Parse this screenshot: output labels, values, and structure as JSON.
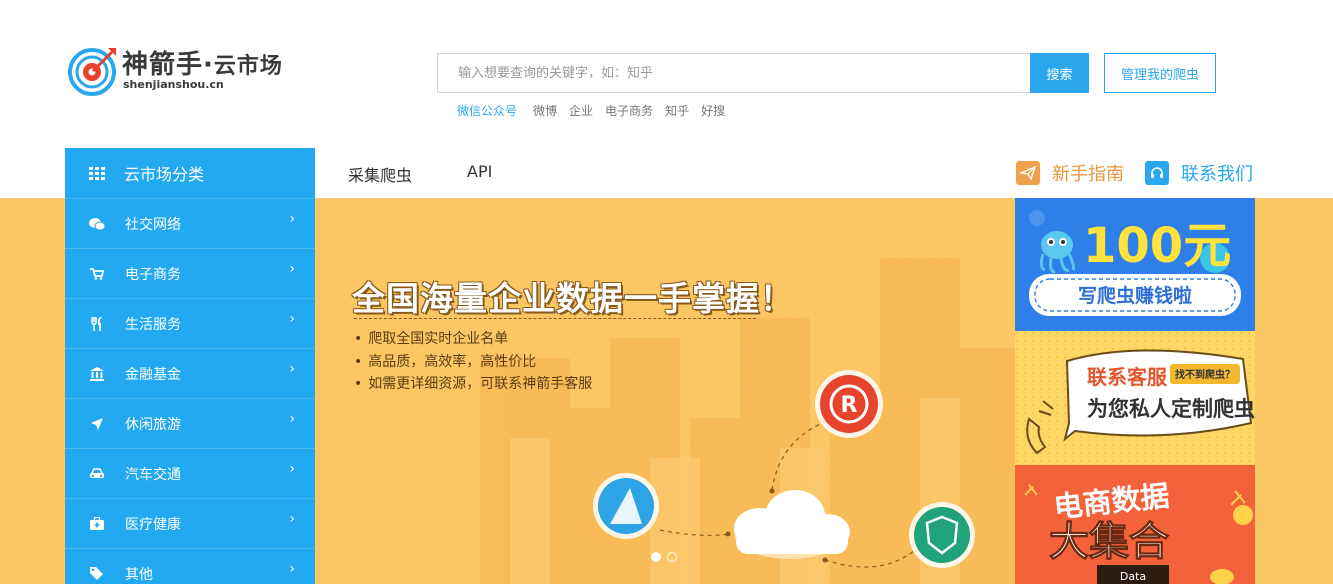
{
  "brand": {
    "name": "神箭手",
    "dot": "·",
    "suffix": "云市场",
    "domain": "shenjianshou.cn"
  },
  "search": {
    "placeholder": "输入想要查询的关键字，如：知乎",
    "button_label": "搜索",
    "manage_label": "管理我的爬虫",
    "hot_words": [
      "微信公众号",
      "微博",
      "企业",
      "电子商务",
      "知乎",
      "好搜"
    ]
  },
  "nav": {
    "category_label": "云市场分类",
    "tabs": [
      "采集爬虫",
      "API"
    ],
    "guide_label": "新手指南",
    "contact_label": "联系我们"
  },
  "sidebar": {
    "items": [
      {
        "label": "社交网络",
        "icon": "chat-icon"
      },
      {
        "label": "电子商务",
        "icon": "cart-icon"
      },
      {
        "label": "生活服务",
        "icon": "cutlery-icon"
      },
      {
        "label": "金融基金",
        "icon": "bank-icon"
      },
      {
        "label": "休闲旅游",
        "icon": "plane-icon"
      },
      {
        "label": "汽车交通",
        "icon": "car-icon"
      },
      {
        "label": "医疗健康",
        "icon": "medkit-icon"
      },
      {
        "label": "其他",
        "icon": "tags-icon"
      }
    ],
    "arrow": "›"
  },
  "banner": {
    "title": "全国海量企业数据一手掌握！",
    "bullets": [
      "爬取全国实时企业名单",
      "高品质，高效率，高性价比",
      "如需更详细资源，可联系神箭手客服"
    ],
    "background_color": "#fbc764",
    "slide_count": 2,
    "active_slide": 1
  },
  "ads": {
    "ad1": {
      "amount": "100元",
      "tagline": "写爬虫赚钱啦"
    },
    "ad2": {
      "line1": "联系客服",
      "tag": "找不到爬虫？",
      "line2": "为您私人定制爬虫"
    },
    "ad3": {
      "line1": "电商数据",
      "line2": "大集合",
      "label": "Data"
    }
  },
  "colors": {
    "accent": "#23a9f1",
    "orange": "#e8963c",
    "banner": "#fbc764"
  }
}
